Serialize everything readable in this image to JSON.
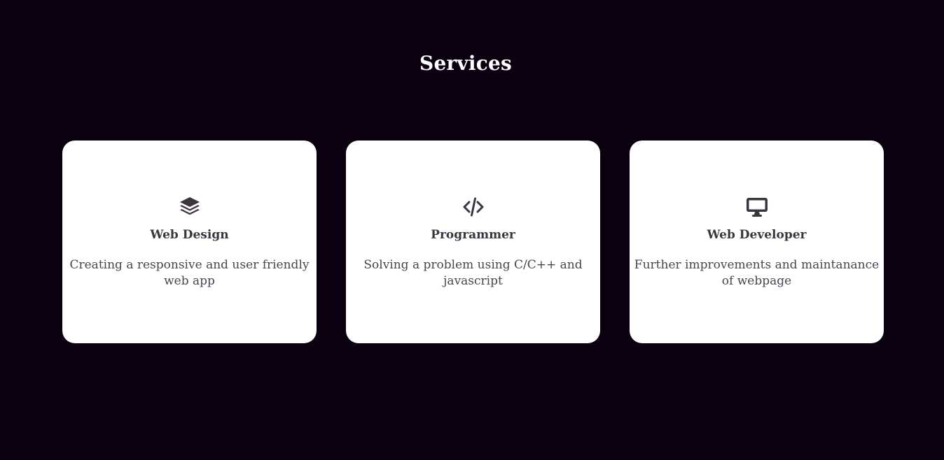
{
  "page": {
    "title": "Services"
  },
  "services": [
    {
      "icon": "layers-icon",
      "title": "Web Design",
      "description": "Creating a responsive and user friendly web app"
    },
    {
      "icon": "code-icon",
      "title": "Programmer",
      "description": "Solving a problem using C/C++ and javascript"
    },
    {
      "icon": "desktop-icon",
      "title": "Web Developer",
      "description": "Further improvements and maintanance of webpage"
    }
  ],
  "colors": {
    "background": "#0b0010",
    "card": "#ffffff",
    "text": "#3b3540",
    "title": "#ffffff"
  }
}
